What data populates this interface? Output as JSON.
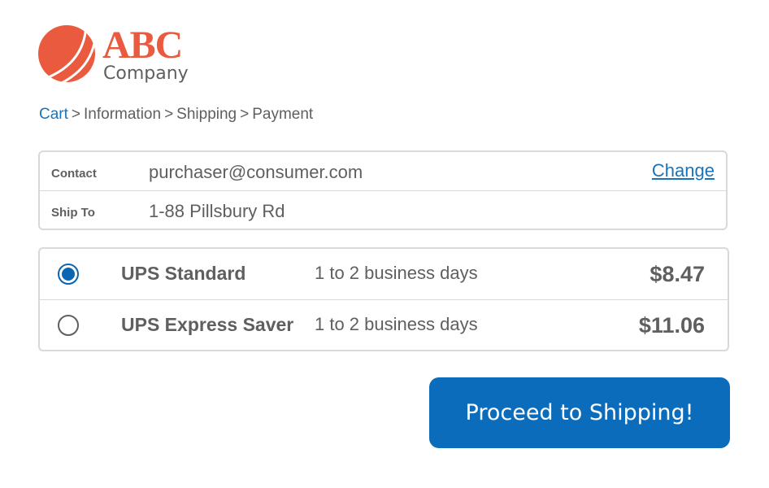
{
  "brand": {
    "name": "ABC",
    "subtitle": "Company",
    "accent_color": "#ea5a3f",
    "icon": "striped-sphere-logo"
  },
  "breadcrumb": {
    "items": [
      "Cart",
      "Information",
      "Shipping",
      "Payment"
    ],
    "separator": ">",
    "link_color": "#1a73b8"
  },
  "contact": {
    "contact_label": "Contact",
    "contact_value": "purchaser@consumer.com",
    "change_label": "Change",
    "ship_to_label": "Ship To",
    "ship_to_value": "1-88 Pillsbury Rd"
  },
  "shipping_options": [
    {
      "name": "UPS Standard",
      "time": "1 to 2 business days",
      "price": "$8.47",
      "selected": true
    },
    {
      "name": "UPS Express Saver",
      "time": "1 to 2 business days",
      "price": "$11.06",
      "selected": false
    }
  ],
  "actions": {
    "proceed_label": "Proceed to Shipping!",
    "button_color": "#0a6cbb"
  }
}
